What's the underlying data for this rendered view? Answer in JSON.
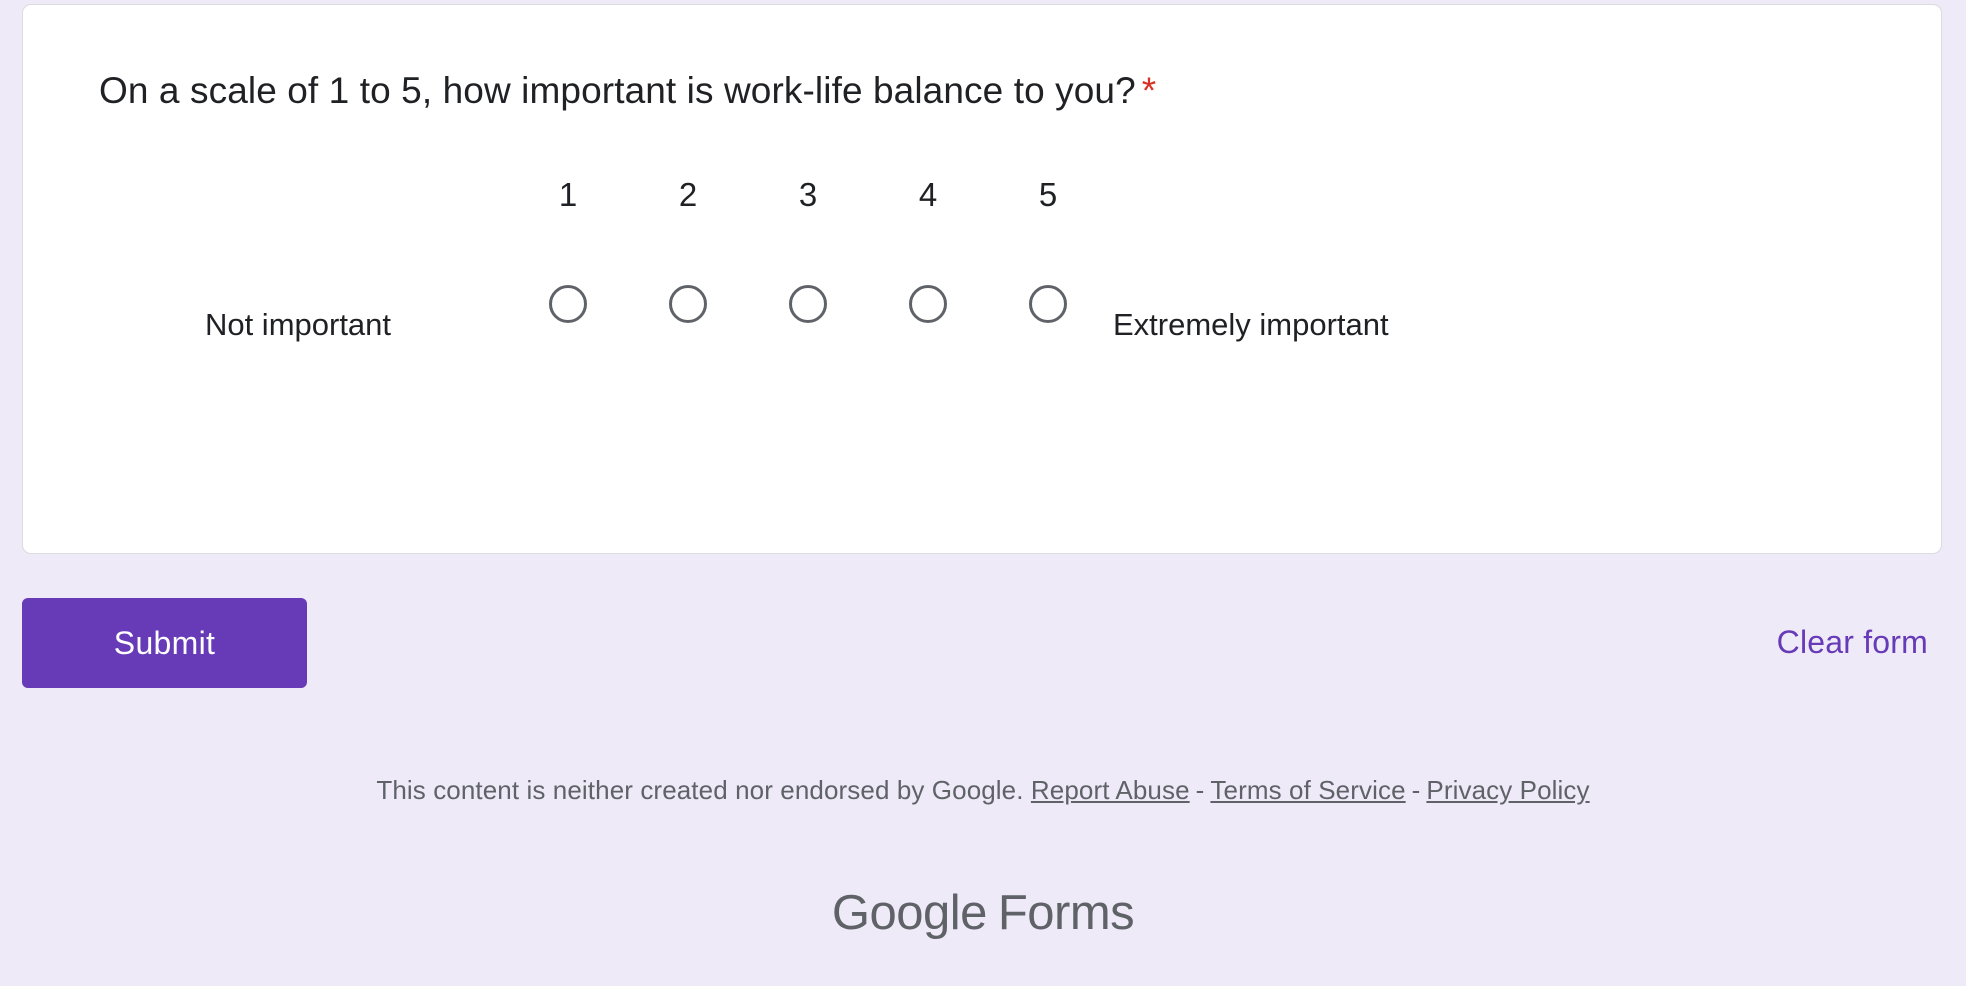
{
  "colors": {
    "page_background": "#eeeaf7",
    "card_background": "#ffffff",
    "card_border": "#dadce0",
    "accent_purple": "#673ab7",
    "required_red": "#d93025",
    "text_primary": "#202124",
    "text_secondary": "#5f6368",
    "radio_stroke": "#5f6368"
  },
  "question": {
    "text": "On a scale of 1 to 5, how important is work-life balance to you?",
    "required_marker": "*",
    "type": "linear-scale"
  },
  "scale": {
    "low_label": "Not important",
    "high_label": "Extremely important",
    "options": [
      {
        "value": "1",
        "selected": false
      },
      {
        "value": "2",
        "selected": false
      },
      {
        "value": "3",
        "selected": false
      },
      {
        "value": "4",
        "selected": false
      },
      {
        "value": "5",
        "selected": false
      }
    ]
  },
  "actions": {
    "submit_label": "Submit",
    "clear_label": "Clear form"
  },
  "footer": {
    "disclaimer": "This content is neither created nor endorsed by Google.",
    "report_abuse": "Report Abuse",
    "terms": "Terms of Service",
    "privacy": "Privacy Policy",
    "separator": "-",
    "logo_google": "Google",
    "logo_forms": "Forms"
  }
}
